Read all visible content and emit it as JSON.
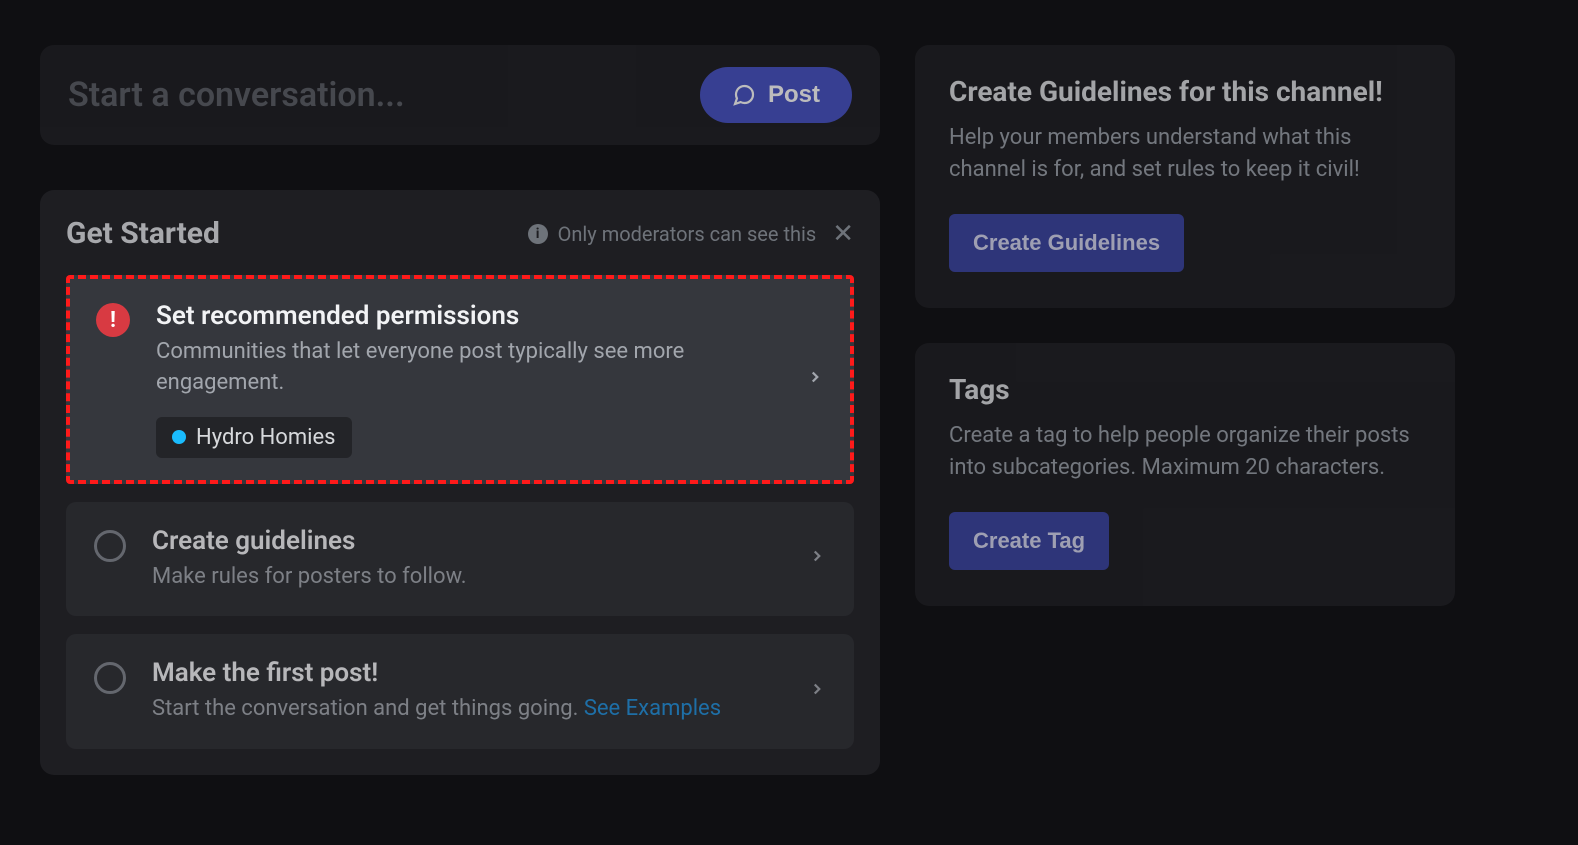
{
  "compose": {
    "placeholder": "Start a conversation...",
    "post_label": "Post"
  },
  "get_started": {
    "title": "Get Started",
    "moderator_note": "Only moderators can see this",
    "items": [
      {
        "title": "Set recommended permissions",
        "desc": "Communities that let everyone post typically see more engagement.",
        "chip": "Hydro Homies"
      },
      {
        "title": "Create guidelines",
        "desc": "Make rules for posters to follow."
      },
      {
        "title": "Make the first post!",
        "desc_prefix": "Start the conversation and get things going. ",
        "desc_link": "See Examples"
      }
    ]
  },
  "guidelines_panel": {
    "title": "Create Guidelines for this channel!",
    "desc": "Help your members understand what this channel is for, and set rules to keep it civil!",
    "button": "Create Guidelines"
  },
  "tags_panel": {
    "title": "Tags",
    "desc": "Create a tag to help people organize their posts into subcategories. Maximum 20 characters.",
    "button": "Create Tag"
  }
}
